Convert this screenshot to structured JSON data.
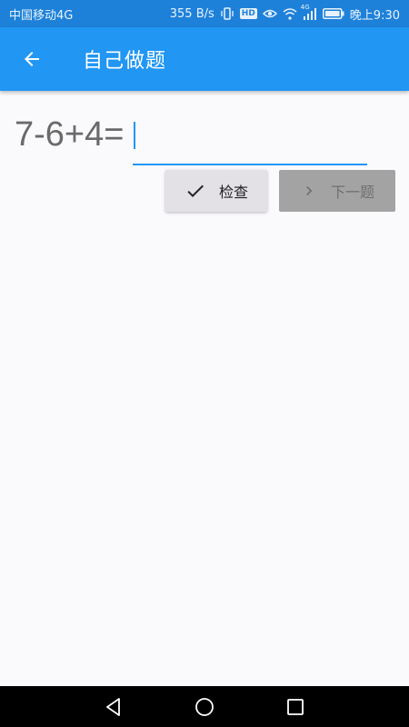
{
  "status_bar": {
    "carrier": "中国移动4G",
    "speed": "355 B/s",
    "hd_badge": "HD",
    "signal_badge": "4G",
    "time": "晚上9:30"
  },
  "app_bar": {
    "title": "自己做题",
    "back_icon": "arrow-left-icon"
  },
  "question": {
    "expression": "7-6+4=",
    "answer_value": ""
  },
  "actions": {
    "check_label": "检查",
    "next_label": "下一题"
  },
  "colors": {
    "primary": "#2196f3",
    "status_bar": "#1e81d9",
    "disabled_button": "#a3a3a3",
    "check_button": "#e3e1e5"
  }
}
